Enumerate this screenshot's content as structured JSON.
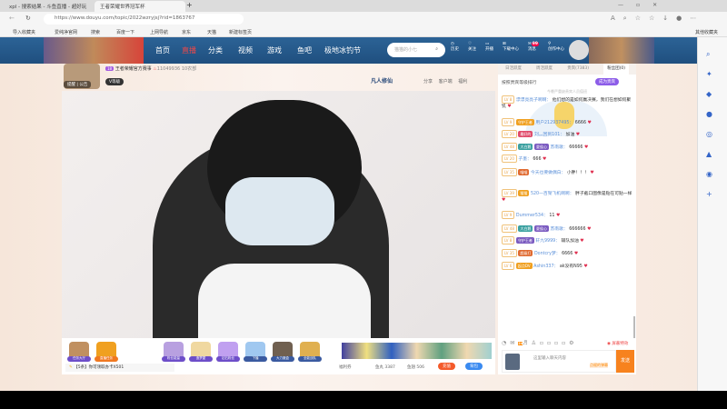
{
  "browser": {
    "tabs": [
      "xpl - 搜索结果 - 斗鱼直播 - 超好玩",
      "王者荣耀世界冠军杯"
    ],
    "url": "https://www.douyu.com/topic/2022wzryjsj?rid=1863767",
    "bookmarks": [
      "导入收藏夹",
      "爱纯净官网",
      "搜索",
      "百度一下",
      "上网导航",
      "京东",
      "天猫",
      "新建标签页"
    ],
    "other_bookmarks": "其他收藏夹"
  },
  "nav": {
    "items": [
      "首页",
      "直播",
      "分类",
      "视频",
      "游戏",
      "鱼吧",
      "极地冰钓节"
    ],
    "search_placeholder": "猫猫的小七",
    "icons": [
      "历史",
      "关注",
      "开播",
      "下载中心",
      "消息",
      "创作中心"
    ],
    "msg_count": "99",
    "avatar_level": "14"
  },
  "room": {
    "level": "18",
    "name": "王者荣耀官方赛事",
    "hot": "11049936",
    "viewers": "10农部",
    "tag": "V等级",
    "follow_actions": [
      "提醒",
      "公告"
    ],
    "actions": [
      "分享",
      "客户端",
      "福利"
    ],
    "sponsor": "凡人修仙"
  },
  "chat": {
    "tabs": [
      "日活跃度",
      "周活跃度",
      "贵宾(7383)",
      "粉丝团(0)"
    ],
    "rank_title": "按照贵宾等级排行",
    "become_vip": "成为贵宾",
    "empty_hint": "今晚严重缺贵宾人员值班",
    "messages": [
      {
        "lv": "LV 8",
        "badges": [],
        "name": "漂漂亮亮子啊啊：",
        "text": "他们想的是如何赢决赛，我们在想如何聚饥"
      },
      {
        "lv": "LV 9",
        "badges": [
          "守护王者"
        ],
        "name": "用户212937495：",
        "text": "6666"
      },
      {
        "lv": "LV 20",
        "badges": [
          "最好的"
        ],
        "name": "刘灬回到101：",
        "text": "加油"
      },
      {
        "lv": "LV 48",
        "badges": [
          "大白鹅",
          "夏侯心"
        ],
        "name": "苏南歌：",
        "text": "66666"
      },
      {
        "lv": "LV 20",
        "badges": [],
        "name": "子墨：",
        "text": "666"
      },
      {
        "lv": "LV 35",
        "badges": [
          "喵喵"
        ],
        "name": "今天也要做偶白：",
        "text": "小胖！！！"
      },
      {
        "lv": "LV 39",
        "badges": [
          "猫猫"
        ],
        "name": "520一百架飞机啊啊：",
        "text": "胖子截口图像是贴在可贴一样"
      },
      {
        "lv": "LV 9",
        "badges": [],
        "name": "Dummer534：",
        "text": "11"
      },
      {
        "lv": "LV 48",
        "badges": [
          "大白鹅",
          "夏侯心"
        ],
        "name": "苏南歌：",
        "text": "666666"
      },
      {
        "lv": "LV 8",
        "badges": [
          "守护王者"
        ],
        "name": "轩九9999：",
        "text": "辅队加油"
      },
      {
        "lv": "LV 35",
        "badges": [
          "超级打"
        ],
        "name": "Dontcry梦：",
        "text": "6666"
      },
      {
        "lv": "LV 6",
        "badges": [
          "起点DV"
        ],
        "name": "Ashin337：",
        "text": "ak没有N95"
      }
    ],
    "toolbar_count": "24",
    "shield": "屏蔽特效",
    "input_placeholder": "这里输入聊天内容",
    "barrage_style": "点缀的弹幕",
    "send": "发送"
  },
  "gifts": {
    "left": [
      "任务大厅",
      "直播任务"
    ],
    "mid": [
      "粉丝能量",
      "造梦屋",
      "钻石粉丝",
      "下播",
      "大力魔盒",
      "全能战队"
    ]
  },
  "bottom": {
    "notice": "【5条】你可领取办卡X501",
    "welfare": "福利券",
    "fish_balls": "鱼丸 3387",
    "fish_fins": "鱼翅 506",
    "recharge": "充值",
    "backpack": "背包"
  }
}
